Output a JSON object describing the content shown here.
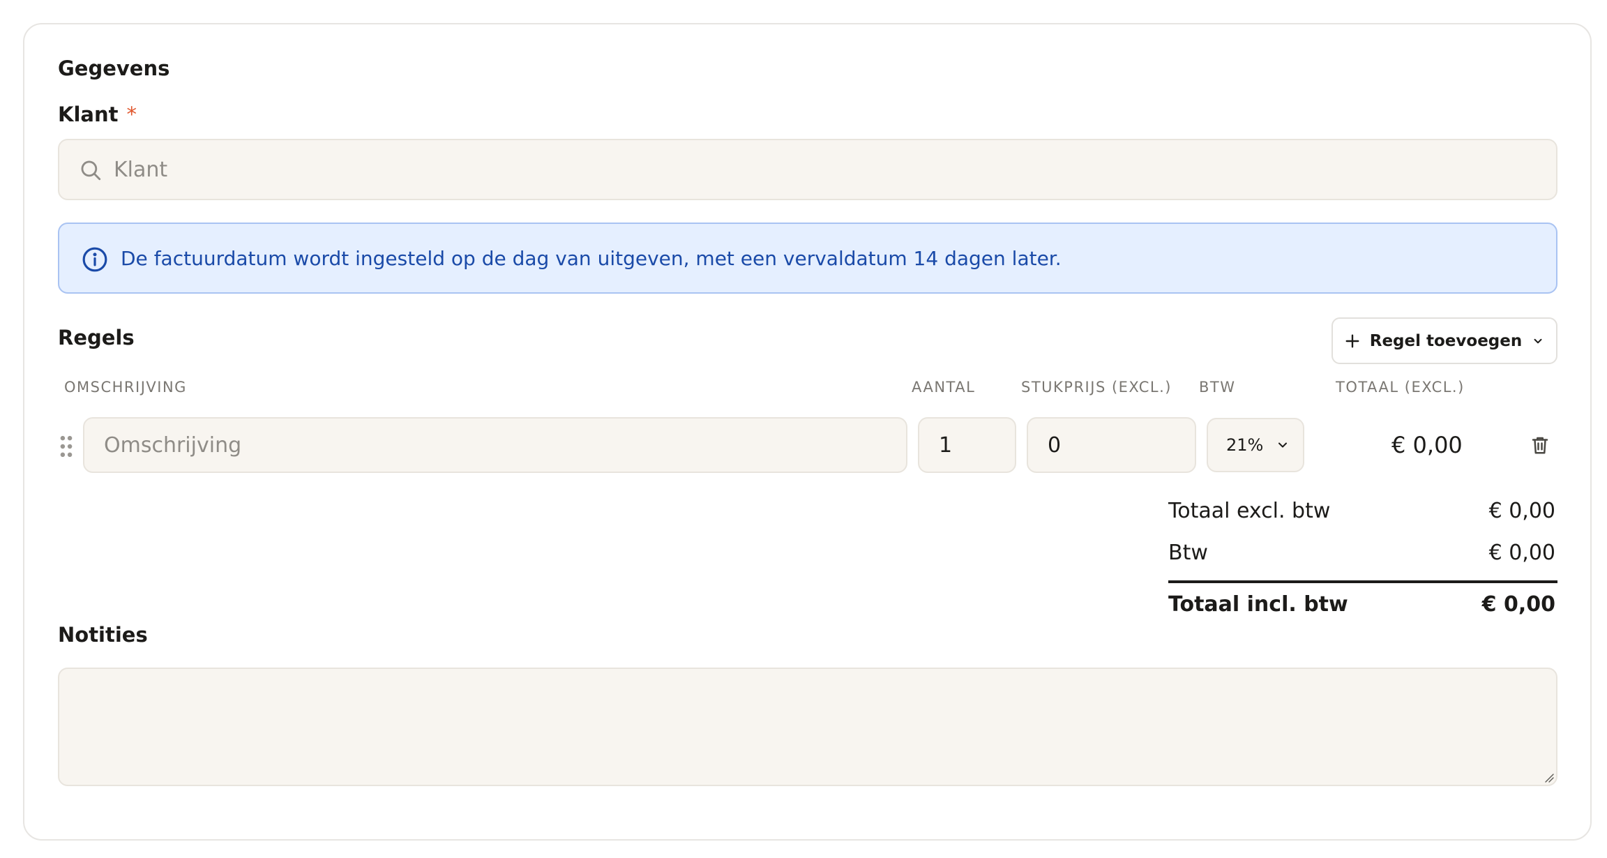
{
  "section": {
    "title": "Gegevens"
  },
  "client": {
    "label": "Klant",
    "required_mark": "*",
    "placeholder": "Klant",
    "value": ""
  },
  "info": {
    "text": "De factuurdatum wordt ingesteld op de dag van uitgeven, met een vervaldatum 14 dagen later."
  },
  "lines": {
    "title": "Regels",
    "add_button_label": "Regel toevoegen",
    "columns": {
      "description": "OMSCHRIJVING",
      "quantity": "AANTAL",
      "unit_price": "STUKPRIJS (EXCL.)",
      "vat": "BTW",
      "total": "TOTAAL (EXCL.)"
    },
    "rows": [
      {
        "description_placeholder": "Omschrijving",
        "description": "",
        "quantity": "1",
        "unit_price": "0",
        "vat": "21%",
        "total": "€ 0,00"
      }
    ]
  },
  "summary": {
    "subtotal_label": "Totaal excl. btw",
    "subtotal_value": "€ 0,00",
    "vat_label": "Btw",
    "vat_value": "€ 0,00",
    "total_label": "Totaal incl. btw",
    "total_value": "€ 0,00"
  },
  "notes": {
    "label": "Notities",
    "value": ""
  },
  "colors": {
    "input_bg": "#f8f5f0",
    "info_bg": "#e5efff",
    "info_text": "#1a4aa8",
    "required": "#e0572e"
  },
  "icons": {
    "search": "search-icon",
    "info": "info-icon",
    "plus": "plus-icon",
    "chevron": "chevron-down-icon",
    "drag": "drag-handle-icon",
    "trash": "trash-icon"
  }
}
